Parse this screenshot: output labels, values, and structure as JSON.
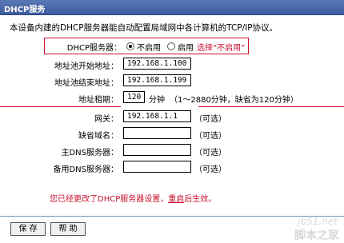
{
  "window": {
    "title": "DHCP服务"
  },
  "intro": "本设备内建的DHCP服务器能自动配置局域网中各计算机的TCP/IP协议。",
  "dhcp_server": {
    "label": "DHCP服务器：",
    "options": [
      "不启用",
      "启用"
    ],
    "selected": "不启用",
    "annotation": "选择“不启用”"
  },
  "form": {
    "pool_start_label": "地址池开始地址：",
    "pool_start_value": "192.168.1.100",
    "pool_end_label": "地址池结束地址：",
    "pool_end_value": "192.168.1.199",
    "lease_label": "地址租期：",
    "lease_value": "120",
    "lease_unit": "分钟",
    "lease_hint": "（1～2880分钟，缺省为120分钟）",
    "gateway_label": "网关：",
    "gateway_value": "192.168.1.1",
    "optional_hint": "（可选）",
    "domain_label": "缺省域名：",
    "domain_value": "",
    "dns1_label": "主DNS服务器：",
    "dns1_value": "",
    "dns2_label": "备用DNS服务器：",
    "dns2_value": ""
  },
  "notice": {
    "prefix": "您已经更改了DHCP服务器设置，",
    "reboot": "重启",
    "suffix": "后生效。"
  },
  "buttons": {
    "save": "保 存",
    "help": "帮 助"
  },
  "watermark": {
    "site": "jb51.net",
    "name": "脚本之家"
  },
  "colors": {
    "accent_red": "#c8102e",
    "title_bar": "#4a67a8"
  }
}
